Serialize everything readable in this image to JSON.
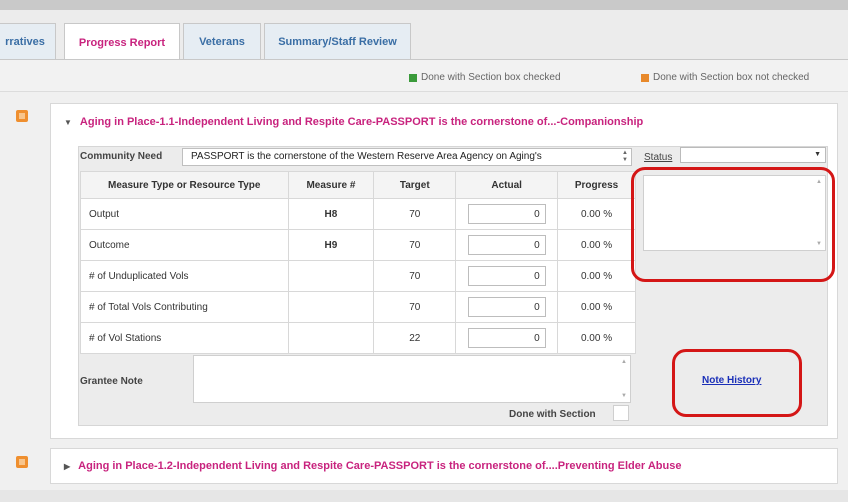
{
  "tabs": [
    {
      "label": "rratives"
    },
    {
      "label": "Progress Report"
    },
    {
      "label": "Veterans"
    },
    {
      "label": "Summary/Staff Review"
    }
  ],
  "legend": {
    "done_checked": "Done with Section box checked",
    "done_not_checked": "Done with Section box not checked",
    "checked_color": "#3a9a3a",
    "not_checked_color": "#e8892b"
  },
  "section1": {
    "title": "Aging in Place-1.1-Independent Living and Respite Care-PASSPORT is the cornerstone of...-Companionship",
    "community_need_label": "Community Need",
    "community_need_value": "PASSPORT is the cornerstone of the Western Reserve Area Agency on Aging's",
    "status_label": "Status",
    "status_value": "",
    "table": {
      "headers": [
        "Measure Type or Resource Type",
        "Measure #",
        "Target",
        "Actual",
        "Progress"
      ],
      "rows": [
        {
          "type": "Output",
          "measure": "H8",
          "target": "70",
          "actual": "0",
          "progress": "0.00 %"
        },
        {
          "type": "Outcome",
          "measure": "H9",
          "target": "70",
          "actual": "0",
          "progress": "0.00 %"
        },
        {
          "type": "# of Unduplicated Vols",
          "measure": "",
          "target": "70",
          "actual": "0",
          "progress": "0.00 %"
        },
        {
          "type": "# of Total Vols Contributing",
          "measure": "",
          "target": "70",
          "actual": "0",
          "progress": "0.00 %"
        },
        {
          "type": "# of Vol Stations",
          "measure": "",
          "target": "22",
          "actual": "0",
          "progress": "0.00 %"
        }
      ]
    },
    "grantee_note_label": "Grantee Note",
    "done_label": "Done with Section",
    "note_history": "Note History"
  },
  "section2": {
    "title": "Aging in Place-1.2-Independent Living and Respite Care-PASSPORT is the cornerstone of....Preventing Elder Abuse"
  }
}
